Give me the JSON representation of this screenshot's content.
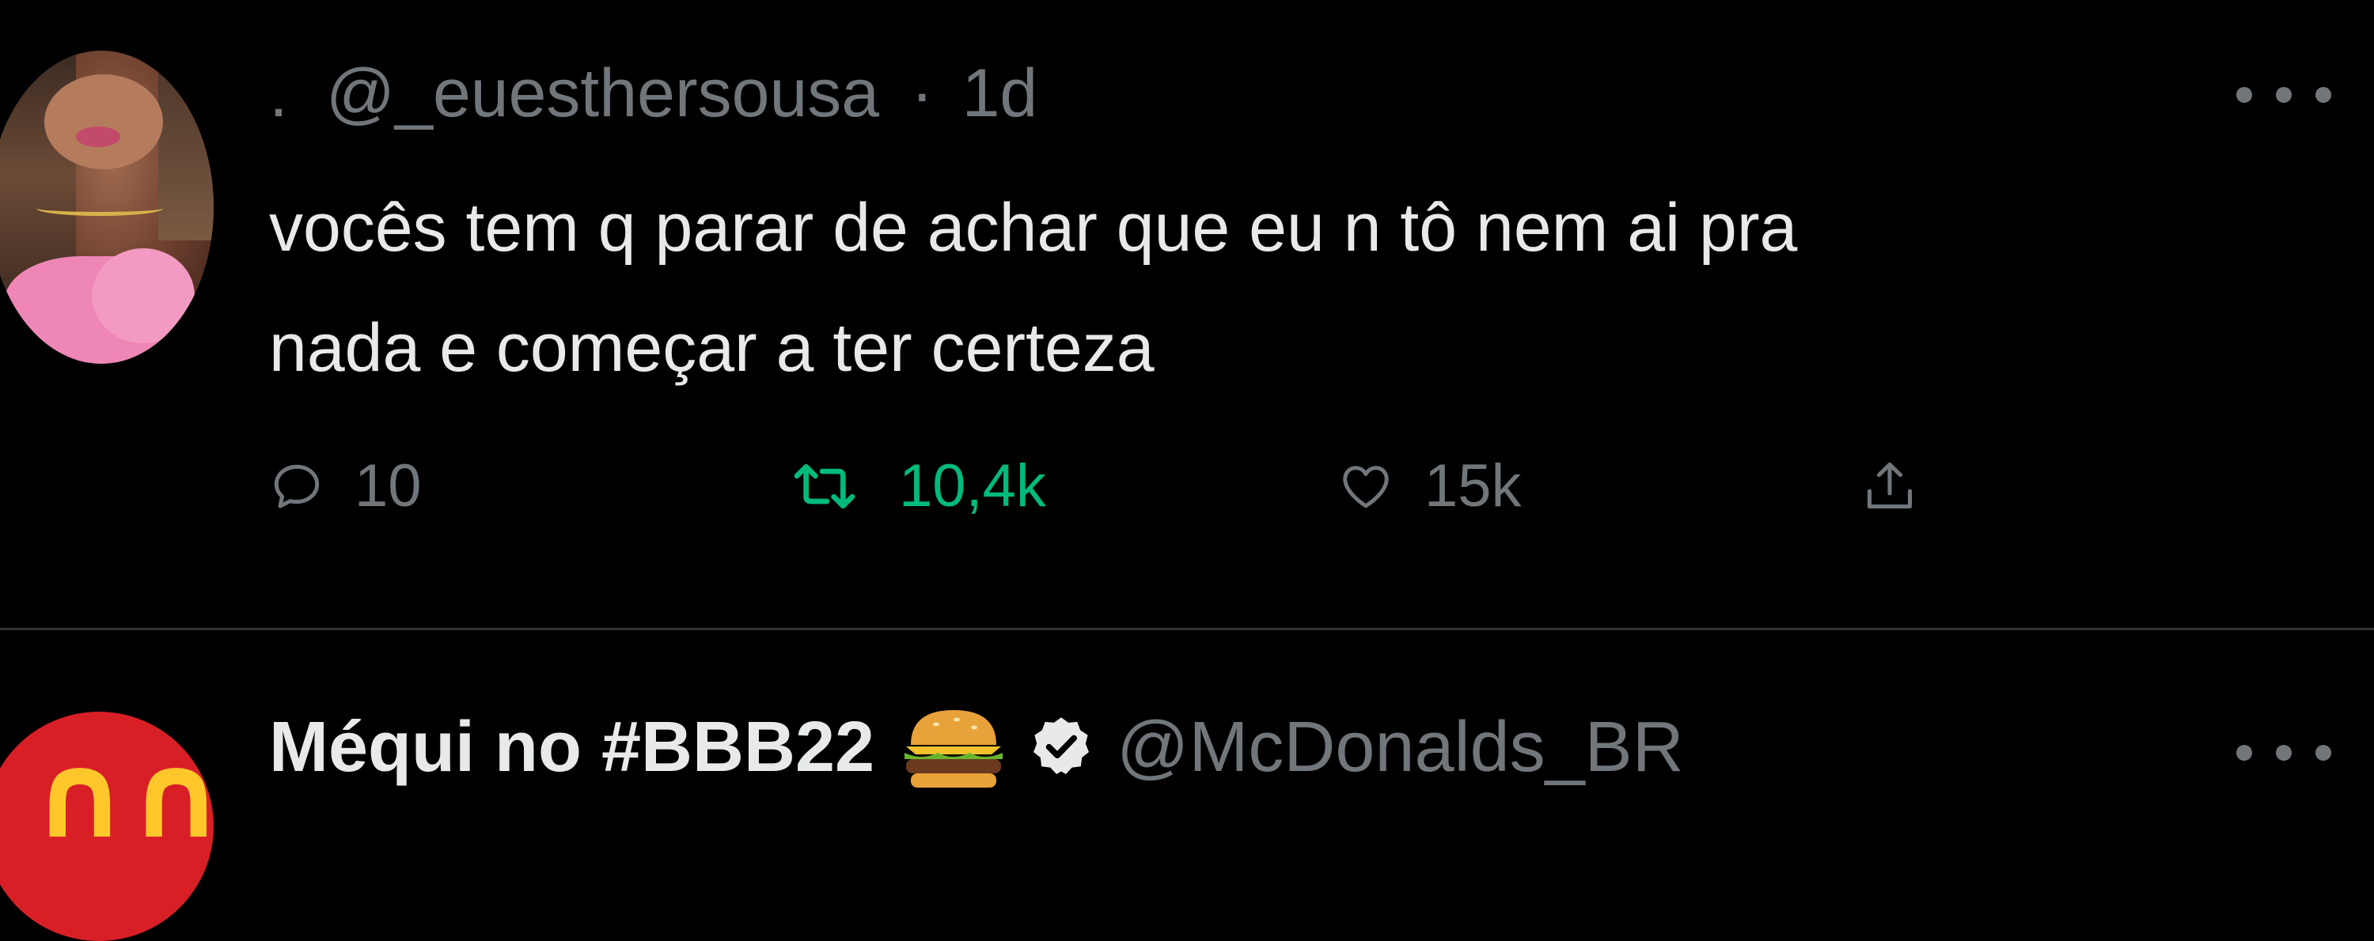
{
  "tweets": [
    {
      "name": ".",
      "handle": "@_euesthersousa",
      "separator": "·",
      "time": "1d",
      "text_lines": [
        "vocês tem q parar de achar que eu n tô nem ai pra",
        "nada e começar a ter certeza"
      ],
      "reply_count": "10",
      "retweet_count": "10,4k",
      "like_count": "15k",
      "retweeted": true
    },
    {
      "name": "Méqui no #BBB22",
      "emoji": "🍔",
      "verified": true,
      "handle": "@McDonalds_BR"
    }
  ],
  "colors": {
    "background": "#000000",
    "text_primary": "#e7e9ea",
    "text_secondary": "#71767b",
    "retweet_active": "#00ba7c",
    "divider": "#2f3336",
    "mcdonalds_red": "#d81f26",
    "mcdonalds_yellow": "#ffc72c"
  },
  "icons": {
    "more": "more-horizontal-icon",
    "reply": "reply-bubble-icon",
    "retweet": "retweet-icon",
    "like": "heart-icon",
    "share": "share-upload-icon",
    "verified": "verified-badge-icon",
    "emoji": "hamburger-emoji-icon"
  }
}
